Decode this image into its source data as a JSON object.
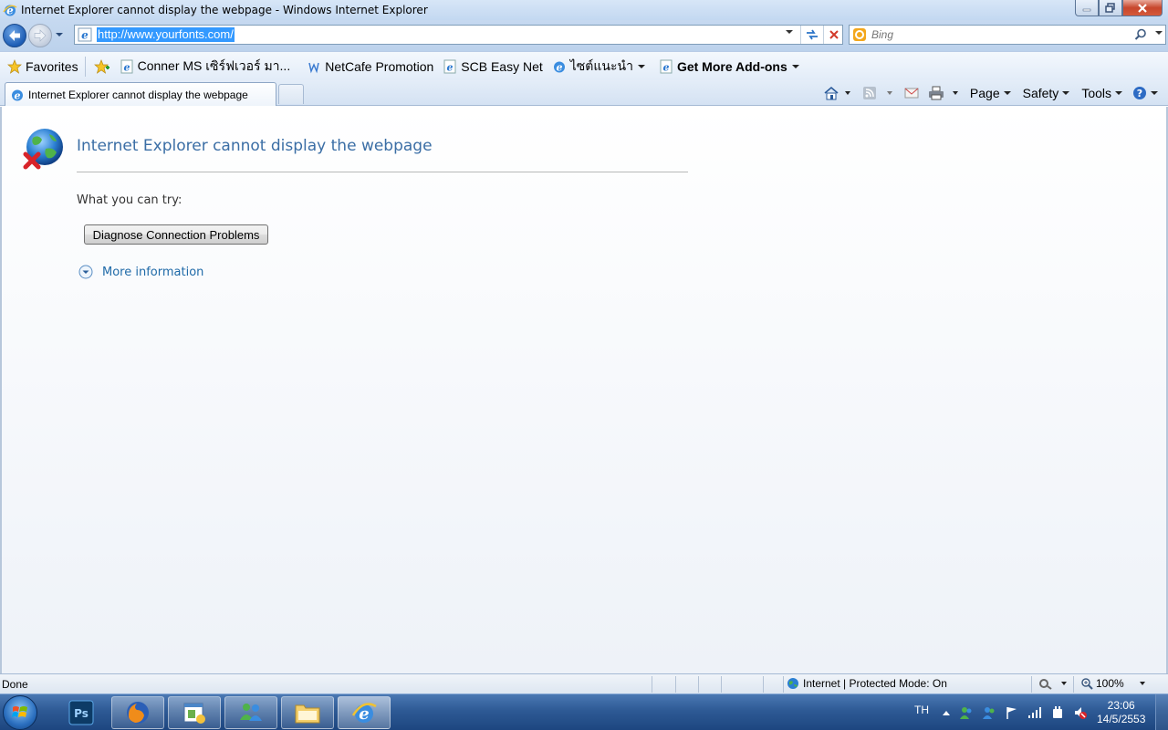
{
  "window": {
    "title": "Internet Explorer cannot display the webpage - Windows Internet Explorer"
  },
  "address_bar": {
    "url": "http://www.yourfonts.com/",
    "search_placeholder": "Bing"
  },
  "favorites_bar": {
    "favorites_label": "Favorites",
    "items": [
      {
        "label": "Conner MS เซิร์ฟเวอร์ มา..."
      },
      {
        "label": "NetCafe Promotion"
      },
      {
        "label": "SCB Easy Net"
      },
      {
        "label": "ไซต์แนะนำ"
      },
      {
        "label": "Get More Add-ons"
      }
    ]
  },
  "tabs": [
    {
      "label": "Internet Explorer cannot display the webpage"
    }
  ],
  "command_bar": {
    "page_label": "Page",
    "safety_label": "Safety",
    "tools_label": "Tools"
  },
  "content": {
    "error_title": "Internet Explorer cannot display the webpage",
    "try_label": "What you can try:",
    "diagnose_button": "Diagnose Connection Problems",
    "more_info": "More information"
  },
  "status_bar": {
    "status": "Done",
    "zone": "Internet | Protected Mode: On",
    "zoom": "100%"
  },
  "taskbar": {
    "language": "TH",
    "time": "23:06",
    "date": "14/5/2553"
  },
  "colors": {
    "link": "#1f6aa8",
    "title_blue": "#3b6ea5",
    "url_highlight": "#3399ff"
  }
}
